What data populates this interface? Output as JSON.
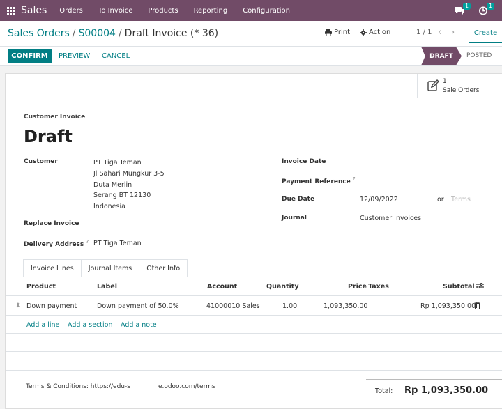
{
  "navbar": {
    "app_name": "Sales",
    "menu": [
      "Orders",
      "To Invoice",
      "Products",
      "Reporting",
      "Configuration"
    ],
    "messages_count": "1",
    "activities_count": "1"
  },
  "control": {
    "breadcrumb": [
      "Sales Orders",
      "S00004",
      "Draft Invoice (* 36)"
    ],
    "print_label": "Print",
    "action_label": "Action",
    "pager": "1 / 1",
    "create_label": "Create"
  },
  "statusbar": {
    "confirm": "CONFIRM",
    "preview": "PREVIEW",
    "cancel": "CANCEL",
    "stages": [
      "DRAFT",
      "POSTED"
    ],
    "active_stage": "DRAFT"
  },
  "smart_button": {
    "count": "1",
    "label": "Sale Orders"
  },
  "invoice": {
    "type": "Customer Invoice",
    "state": "Draft",
    "customer_label": "Customer",
    "customer_lines": [
      "PT Tiga Teman",
      "Jl Sahari Mungkur 3-5",
      "Duta Merlin",
      "Serang BT 12130",
      "Indonesia"
    ],
    "replace_label": "Replace Invoice",
    "delivery_label": "Delivery Address",
    "delivery_help": "?",
    "delivery_value": "PT Tiga Teman",
    "invoice_date_label": "Invoice Date",
    "payment_ref_label": "Payment Reference",
    "payment_ref_help": "?",
    "due_date_label": "Due Date",
    "due_date_value": "12/09/2022",
    "or_text": "or",
    "terms_placeholder": "Terms",
    "journal_label": "Journal",
    "journal_value": "Customer Invoices"
  },
  "tabs": [
    "Invoice Lines",
    "Journal Items",
    "Other Info"
  ],
  "table": {
    "headers": [
      "Product",
      "Label",
      "Account",
      "Quantity",
      "Price",
      "Taxes",
      "Subtotal"
    ],
    "rows": [
      {
        "product": "Down payment",
        "label": "Down payment of 50.0%",
        "account": "41000010 Sales",
        "quantity": "1.00",
        "price": "1,093,350.00",
        "taxes": "",
        "subtotal": "Rp 1,093,350.00"
      }
    ],
    "add_line": "Add a line",
    "add_section": "Add a section",
    "add_note": "Add a note"
  },
  "footer": {
    "terms_prefix": "Terms & Conditions: https://edu-s",
    "terms_suffix": "e.odoo.com/terms",
    "total_label": "Total:",
    "total_value": "Rp 1,093,350.00"
  },
  "colors": {
    "brand": "#714b67",
    "accent": "#017e84"
  }
}
